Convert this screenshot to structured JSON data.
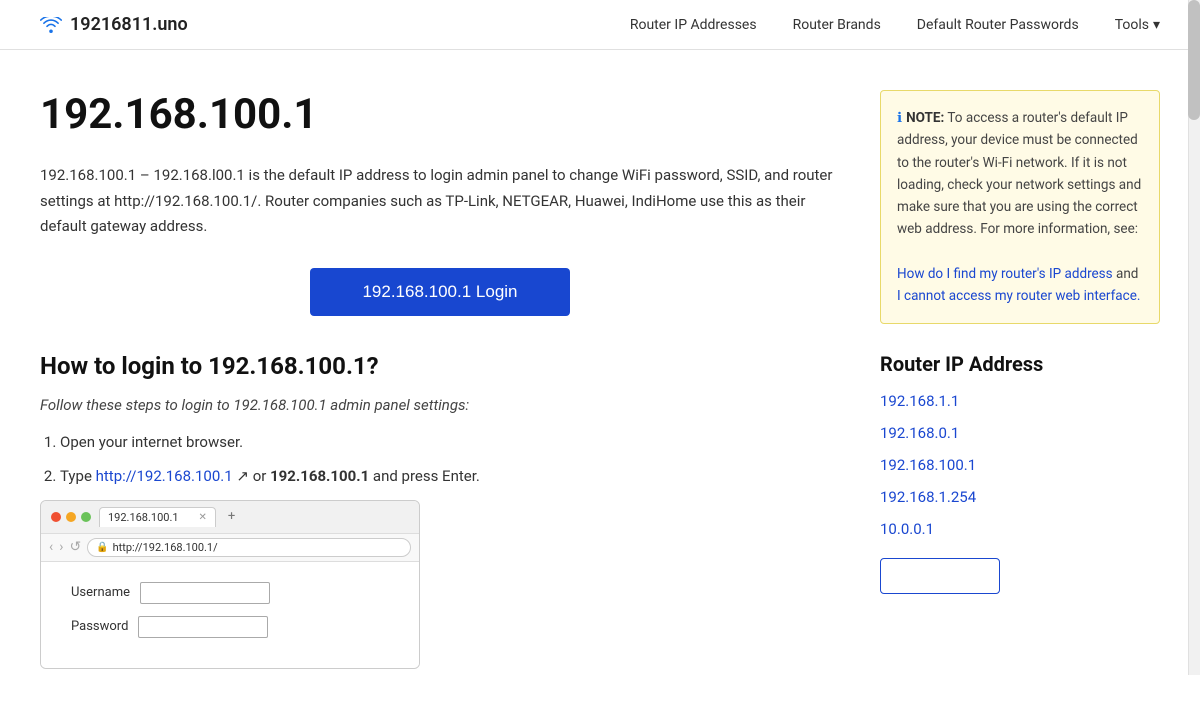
{
  "site": {
    "logo_text": "19216811.uno",
    "wifi_icon": "wifi"
  },
  "nav": {
    "links": [
      {
        "id": "router-ip-addresses",
        "label": "Router IP Addresses",
        "href": "#"
      },
      {
        "id": "router-brands",
        "label": "Router Brands",
        "href": "#"
      },
      {
        "id": "default-router-passwords",
        "label": "Default Router Passwords",
        "href": "#"
      }
    ],
    "tools_label": "Tools",
    "tools_chevron": "▾"
  },
  "main": {
    "ip_title": "192.168.100.1",
    "description": "192.168.100.1 – 192.168.l00.1 is the default IP address to login admin panel to change WiFi password, SSID, and router settings at http://192.168.100.1/. Router companies such as TP-Link, NETGEAR, Huawei, IndiHome use this as their default gateway address.",
    "login_btn_label": "192.168.100.1 Login",
    "how_to_title": "How to login to 192.168.100.1?",
    "steps_intro": "Follow these steps to login to 192.168.100.1 admin panel settings:",
    "steps": [
      {
        "text": "Open your internet browser.",
        "link": null,
        "link_text": null,
        "bold_text": null
      },
      {
        "text_before": "Type ",
        "link": "http://192.168.100.1",
        "link_text": "http://192.168.100.1",
        "text_middle": " or ",
        "bold_text": "192.168.100.1",
        "text_after": " and press Enter."
      }
    ],
    "browser_tab_text": "192.168.100.1",
    "browser_url": "http://192.168.100.1/",
    "browser_form_username": "Username",
    "browser_form_password": "Password"
  },
  "sidebar": {
    "note_label": "NOTE:",
    "note_text": "To access a router's default IP address, your device must be connected to the router's Wi-Fi network. If it is not loading, check your network settings and make sure that you are using the correct web address. For more information, see:",
    "note_link1_text": "How do I find my router's IP address",
    "note_link2_text": "I cannot access my router web interface.",
    "note_link2_connector": "and",
    "router_ip_section_title": "Router IP Address",
    "ip_links": [
      {
        "label": "192.168.1.1",
        "href": "#"
      },
      {
        "label": "192.168.0.1",
        "href": "#"
      },
      {
        "label": "192.168.100.1",
        "href": "#"
      },
      {
        "label": "192.168.1.254",
        "href": "#"
      },
      {
        "label": "10.0.0.1",
        "href": "#"
      }
    ]
  }
}
